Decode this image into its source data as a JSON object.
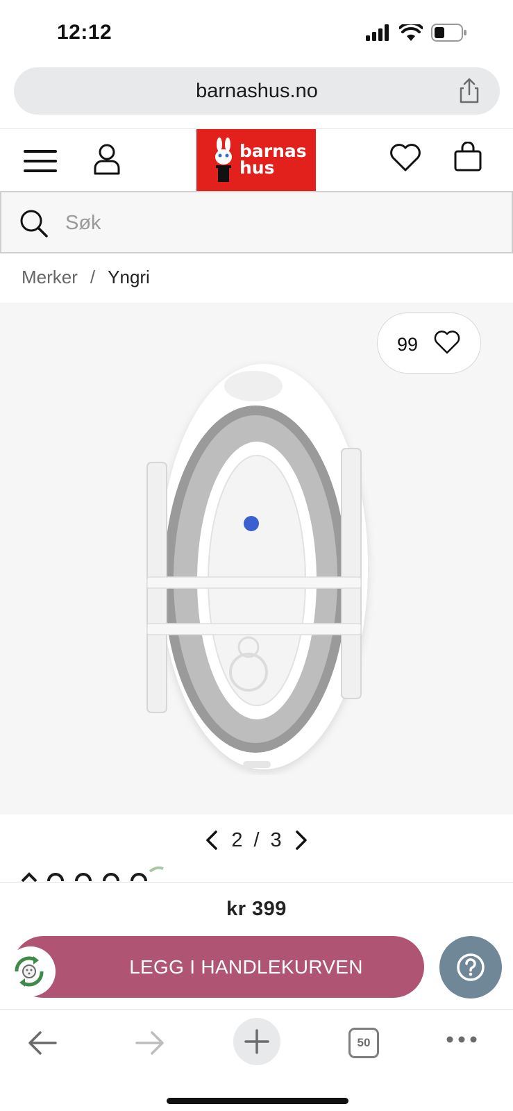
{
  "status": {
    "time": "12:12",
    "icons": [
      "signal-icon",
      "wifi-icon",
      "battery-icon"
    ]
  },
  "browser": {
    "url": "barnashus.no",
    "tab_count": "50"
  },
  "header": {
    "logo_line1": "barnas",
    "logo_line2": "hus",
    "logo_color": "#e2211c"
  },
  "search": {
    "placeholder": "Søk"
  },
  "breadcrumb": {
    "items": [
      "Merker",
      "Yngri"
    ],
    "separator": "/"
  },
  "product": {
    "wishlist_count": "99",
    "image_index": "2",
    "image_separator": "/",
    "image_total": "3",
    "price": "kr 399",
    "add_to_cart_label": "LEGG I HANDLEKURVEN",
    "accent_color": "#b05473",
    "help_color": "#6f8797"
  }
}
